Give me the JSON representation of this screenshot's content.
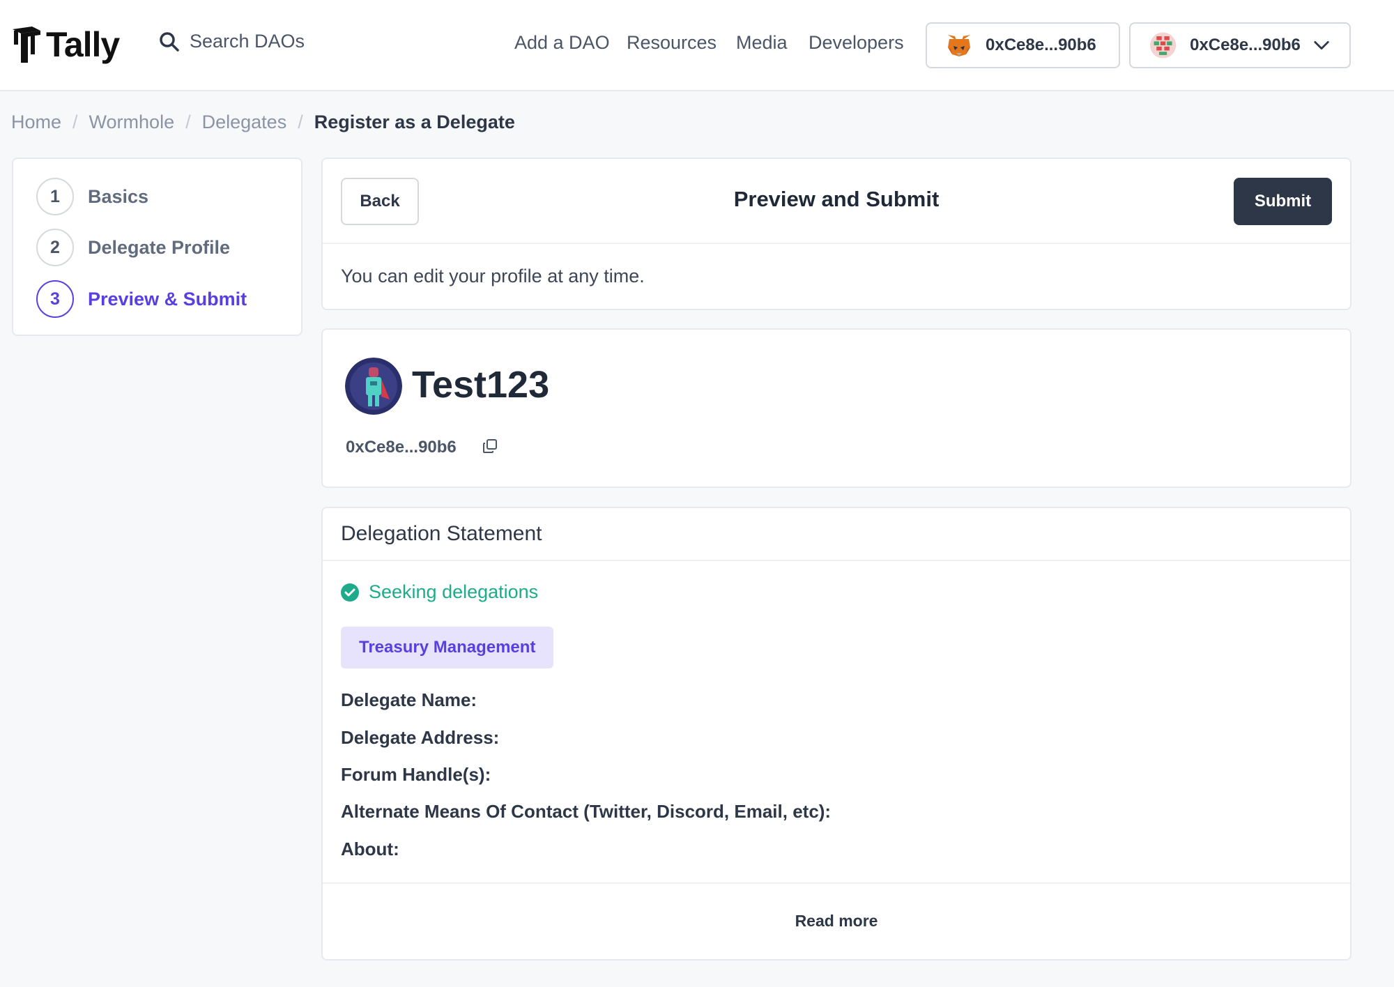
{
  "header": {
    "logo_text": "Tally",
    "search_placeholder": "Search DAOs",
    "nav": [
      "Add a DAO",
      "Resources",
      "Media",
      "Developers"
    ],
    "wallet_connected": "0xCe8e...90b6",
    "account_menu": "0xCe8e...90b6"
  },
  "breadcrumb": {
    "items": [
      "Home",
      "Wormhole",
      "Delegates"
    ],
    "current": "Register as a Delegate",
    "separator": "/"
  },
  "stepper": {
    "steps": [
      {
        "number": "1",
        "label": "Basics"
      },
      {
        "number": "2",
        "label": "Delegate Profile"
      },
      {
        "number": "3",
        "label": "Preview & Submit"
      }
    ]
  },
  "preview": {
    "back_label": "Back",
    "title": "Preview and Submit",
    "submit_label": "Submit",
    "note": "You can edit your profile at any time."
  },
  "profile": {
    "name": "Test123",
    "address": "0xCe8e...90b6"
  },
  "statement": {
    "title": "Delegation Statement",
    "seeking": "Seeking delegations",
    "tag": "Treasury Management",
    "fields": [
      "Delegate Name:",
      "Delegate Address:",
      "Forum Handle(s):",
      "Alternate Means Of Contact (Twitter, Discord, Email, etc):",
      "About:"
    ],
    "read_more": "Read more"
  },
  "colors": {
    "accent": "#5a3fe0",
    "submit_bg": "#2d3748",
    "seeking_green": "#1eab8c",
    "tag_bg": "#e7e3fd"
  }
}
